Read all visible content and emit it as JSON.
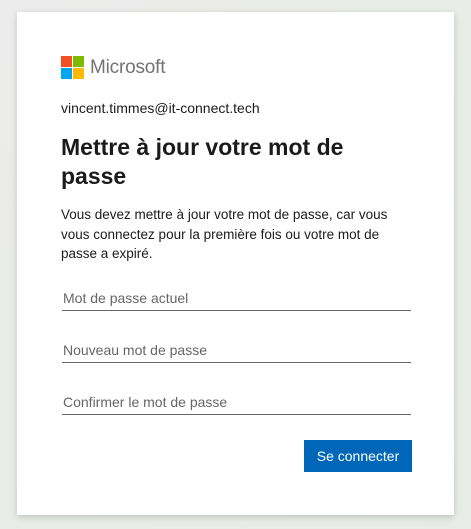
{
  "brand": {
    "name": "Microsoft",
    "logo_colors": [
      "#f25022",
      "#7fba00",
      "#00a4ef",
      "#ffb900"
    ]
  },
  "account": {
    "email": "vincent.timmes@it-connect.tech"
  },
  "heading": "Mettre à jour votre mot de passe",
  "description": "Vous devez mettre à jour votre mot de passe, car vous vous connectez pour la première fois ou votre mot de passe a expiré.",
  "fields": {
    "current_password": {
      "value": "",
      "placeholder": "Mot de passe actuel"
    },
    "new_password": {
      "value": "",
      "placeholder": "Nouveau mot de passe"
    },
    "confirm_password": {
      "value": "",
      "placeholder": "Confirmer le mot de passe"
    }
  },
  "submit": {
    "label": "Se connecter",
    "color": "#0067b8"
  }
}
